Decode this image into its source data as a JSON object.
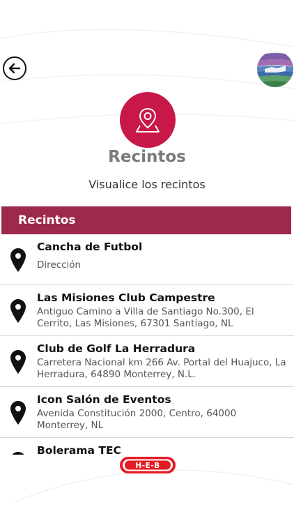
{
  "header": {
    "back_icon": "arrow-left-circle-icon",
    "logo_icon": "handshake-landscape-logo"
  },
  "hero": {
    "icon": "map-pin-location-icon",
    "title": "Recintos",
    "subtitle": "Visualice los recintos"
  },
  "section": {
    "header": "Recintos"
  },
  "venues": [
    {
      "name": "Cancha de Futbol",
      "address": "Dirección"
    },
    {
      "name": "Las Misiones Club Campestre",
      "address": "Antiguo Camino a Villa de Santiago No.300, El Cerrito, Las Misiones, 67301 Santiago, NL"
    },
    {
      "name": "Club de Golf La Herradura",
      "address": "Carretera Nacional km 266 Av. Portal del Huajuco, La Herradura, 64890 Monterrey, N.L."
    },
    {
      "name": "Icon Salón de Eventos",
      "address": "Avenida Constitución 2000, Centro, 64000 Monterrey, NL"
    },
    {
      "name": "Bolerama TEC",
      "address": ""
    }
  ],
  "sponsor": {
    "logo_text": "H-E-B"
  },
  "colors": {
    "accent": "#c8184a",
    "section_header": "#9e2a4b",
    "title_gray": "#7a7a7a"
  }
}
